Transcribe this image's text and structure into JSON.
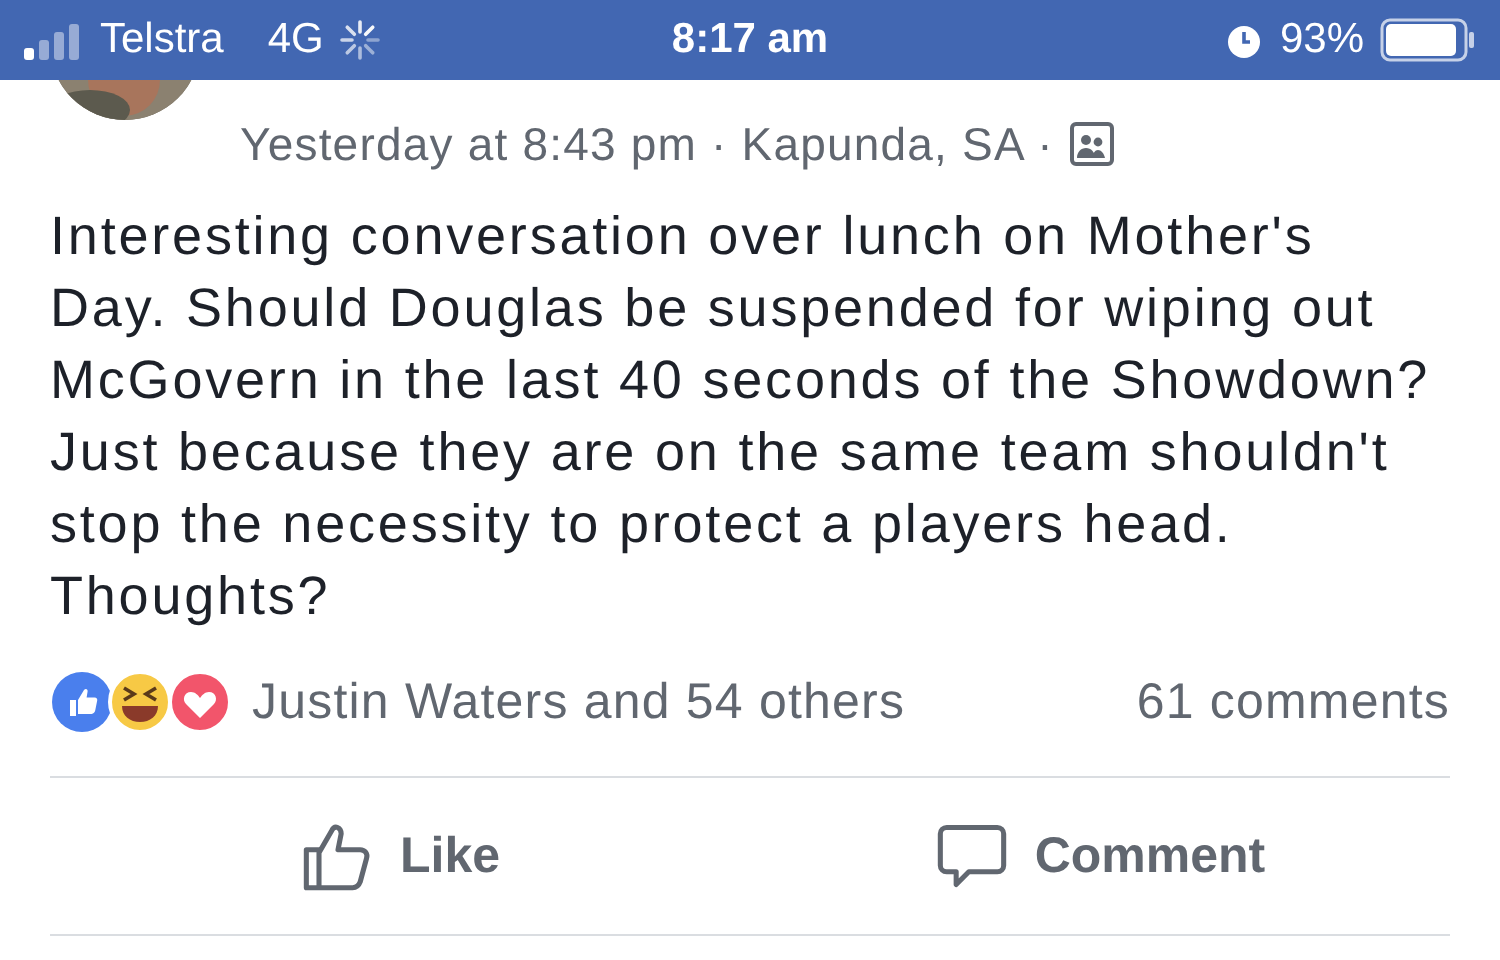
{
  "status_bar": {
    "carrier": "Telstra",
    "network": "4G",
    "time": "8:17 am",
    "battery": "93%"
  },
  "post": {
    "meta": "Yesterday at 8:43 pm · Kapunda, SA ·",
    "text": "Interesting conversation over lunch on Mother's Day. Should Douglas be suspended for wiping out McGovern in the last 40 seconds of the Showdown? Just because they are on the same team shouldn't stop the necessity to protect a players head. Thoughts?",
    "reactions_summary": "Justin Waters and 54 others",
    "comments_count": "61 comments"
  },
  "actions": [
    {
      "kind": "like",
      "label": "Like"
    },
    {
      "kind": "comment",
      "label": "Comment"
    }
  ]
}
